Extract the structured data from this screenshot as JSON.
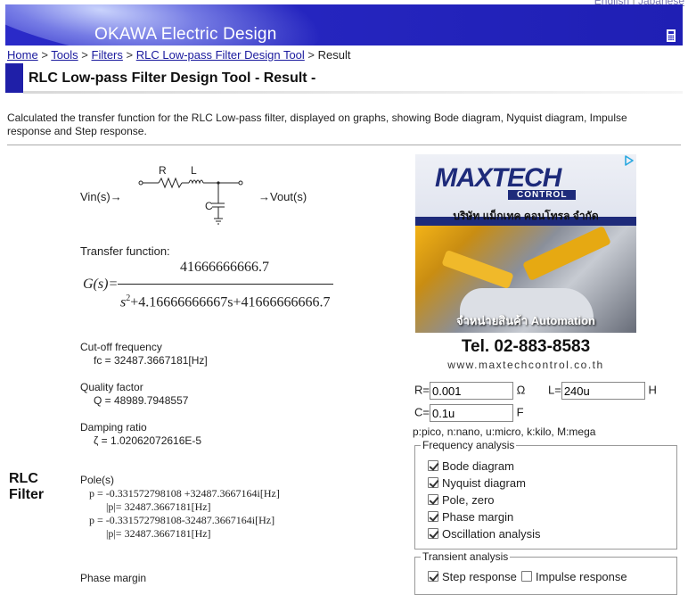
{
  "lang": {
    "english": "English",
    "separator": "|",
    "japanese": "Japanese"
  },
  "header": {
    "brand": "OKAWA Electric Design",
    "calc_icon": "calculator-icon"
  },
  "breadcrumb": {
    "items": [
      "Home",
      "Tools",
      "Filters",
      "RLC Low-pass Filter Design Tool"
    ],
    "current": "Result",
    "sep": ">"
  },
  "page": {
    "title": "RLC Low-pass Filter Design Tool - Result -"
  },
  "description": "Calculated the transfer function for the RLC Low-pass filter, displayed on graphs, showing Bode diagram, Nyquist diagram, Impulse response and Step response.",
  "side_label": {
    "line1": "RLC",
    "line2": "Filter"
  },
  "circuit": {
    "vin": "Vin(s)→",
    "vout": "→Vout(s)",
    "r": "R",
    "l": "L",
    "c": "C"
  },
  "transfer": {
    "label": "Transfer function:",
    "numerator": "41666666666.7",
    "g": "G(s)=",
    "den_s2": "s",
    "den_exp": "2",
    "den_rest": "+4.16666666667s+41666666666.7"
  },
  "cutoff": {
    "label": "Cut-off frequency",
    "value": "fc = 32487.3667181[Hz]"
  },
  "quality": {
    "label": "Quality factor",
    "value": "Q = 48989.7948557"
  },
  "damping": {
    "label": "Damping ratio",
    "value": "ζ = 1.02062072616E-5"
  },
  "poles": {
    "label": "Pole(s)",
    "p1": "p = -0.331572798108 +32487.3667164i[Hz]",
    "p1_abs": "|p|= 32487.3667181[Hz]",
    "p2": "p = -0.331572798108-32487.3667164i[Hz]",
    "p2_abs": "|p|= 32487.3667181[Hz]"
  },
  "phase_margin": {
    "label": "Phase margin"
  },
  "ad": {
    "brand": "MAXTECH",
    "sub": "CONTROL",
    "thai_company": "บริษัท แม็กเทค คอนโทรล จำกัด",
    "thai_auto": "จำหน่ายสินค้า",
    "auto": "Automation",
    "tel": "Tel. 02-883-8583",
    "web": "www.maxtechcontrol.co.th",
    "choices_icon": "adchoices-icon"
  },
  "form": {
    "r_label": "R=",
    "r_value": "0.001",
    "r_unit": "Ω",
    "l_label": "L=",
    "l_value": "240u",
    "l_unit": "H",
    "c_label": "C=",
    "c_value": "0.1u",
    "c_unit": "F",
    "units_hint": "p:pico, n:nano, u:micro, k:kilo, M:mega"
  },
  "freq_analysis": {
    "legend": "Frequency analysis",
    "items": [
      {
        "label": "Bode diagram",
        "checked": true
      },
      {
        "label": "Nyquist diagram",
        "checked": true
      },
      {
        "label": "Pole, zero",
        "checked": true
      },
      {
        "label": "Phase margin",
        "checked": true
      },
      {
        "label": "Oscillation analysis",
        "checked": true
      }
    ]
  },
  "transient": {
    "legend": "Transient analysis",
    "step": {
      "label": "Step response",
      "checked": true
    },
    "impulse": {
      "label": "Impulse response",
      "checked": false
    }
  },
  "colors": {
    "banner": "#2424c0",
    "title_mark": "#1f1fa8",
    "link": "#1a1a9e"
  }
}
